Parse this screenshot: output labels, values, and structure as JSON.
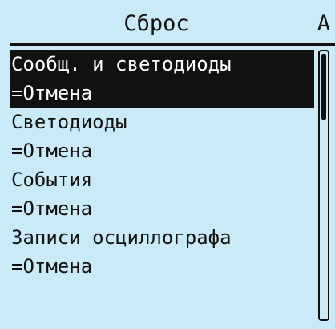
{
  "header": {
    "title": "Сброс",
    "corner": "A"
  },
  "menu": {
    "items": [
      {
        "label": "Сообщ. и светодиоды",
        "value": "=Отмена",
        "selected": true
      },
      {
        "label": "Светодиоды",
        "value": "=Отмена",
        "selected": false
      },
      {
        "label": "События",
        "value": "=Отмена",
        "selected": false
      },
      {
        "label": "Записи осциллографа",
        "value": "=Отмена",
        "selected": false
      }
    ]
  },
  "scroll": {
    "position_fraction": 0.0,
    "visible_fraction": 0.25
  },
  "colors": {
    "background": "#c9eaf6",
    "foreground": "#111111",
    "highlight_text": "#ffffff"
  }
}
